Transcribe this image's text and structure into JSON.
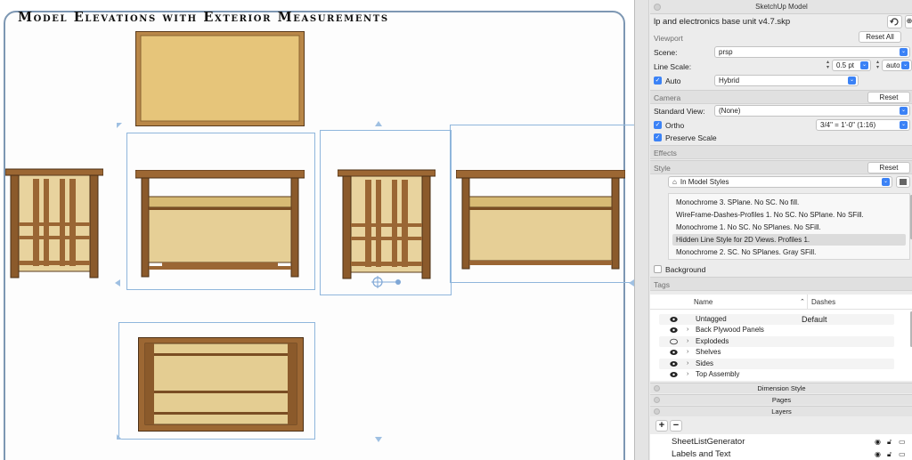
{
  "canvas": {
    "title": "Model Elevations with Exterior Measurements"
  },
  "panel": {
    "title": "SketchUp Model",
    "file_name": "lp and electronics base unit v4.7.skp",
    "viewport": {
      "header": "Viewport",
      "reset_all_label": "Reset All",
      "scene_label": "Scene:",
      "scene_value": "prsp",
      "line_scale_label": "Line Scale:",
      "line_scale_value": "0.5 pt",
      "line_scale_mode": "auto",
      "auto_label": "Auto",
      "auto_mode": "Hybrid"
    },
    "camera": {
      "header": "Camera",
      "reset_label": "Reset",
      "standard_view_label": "Standard View:",
      "standard_view_value": "(None)",
      "ortho_label": "Ortho",
      "ortho_scale": "3/4\" = 1'-0\" (1:16)",
      "preserve_scale_label": "Preserve Scale"
    },
    "effects": {
      "header": "Effects"
    },
    "style": {
      "header": "Style",
      "reset_label": "Reset",
      "source_value": "In Model Styles",
      "items": [
        "Monochrome 3. SPlane. No SC. No fill.",
        "WireFrame-Dashes-Profiles 1. No SC. No SPlane. No SFill.",
        "Monochrome 1. No SC. No SPlanes. No SFill.",
        "Hidden Line Style for 2D Views. Profiles 1.",
        "Monochrome 2. SC. No SPlanes. Gray SFill."
      ],
      "selected_index": 3,
      "background_label": "Background"
    },
    "tags": {
      "header": "Tags",
      "col_name": "Name",
      "col_dashes": "Dashes",
      "rows": [
        {
          "name": "Untagged",
          "dashes": "Default",
          "visible": true,
          "expandable": false
        },
        {
          "name": "Back Plywood Panels",
          "dashes": "",
          "visible": true,
          "expandable": true
        },
        {
          "name": "Explodeds",
          "dashes": "",
          "visible": false,
          "expandable": true
        },
        {
          "name": "Shelves",
          "dashes": "",
          "visible": true,
          "expandable": true
        },
        {
          "name": "Sides",
          "dashes": "",
          "visible": true,
          "expandable": true
        },
        {
          "name": "Top Assembly",
          "dashes": "",
          "visible": true,
          "expandable": true
        }
      ]
    },
    "dimension_style": {
      "header": "Dimension Style"
    },
    "pages": {
      "header": "Pages"
    },
    "layers": {
      "header": "Layers",
      "rows": [
        {
          "name": "SheetListGenerator"
        },
        {
          "name": "Labels and Text"
        }
      ]
    },
    "icons": {
      "refresh": "refresh-icon",
      "lock": "lock-icon",
      "home": "home-icon",
      "eye": "eye-icon",
      "add": "plus-icon",
      "remove": "minus-icon"
    },
    "accent_color": "#3b82f6"
  }
}
